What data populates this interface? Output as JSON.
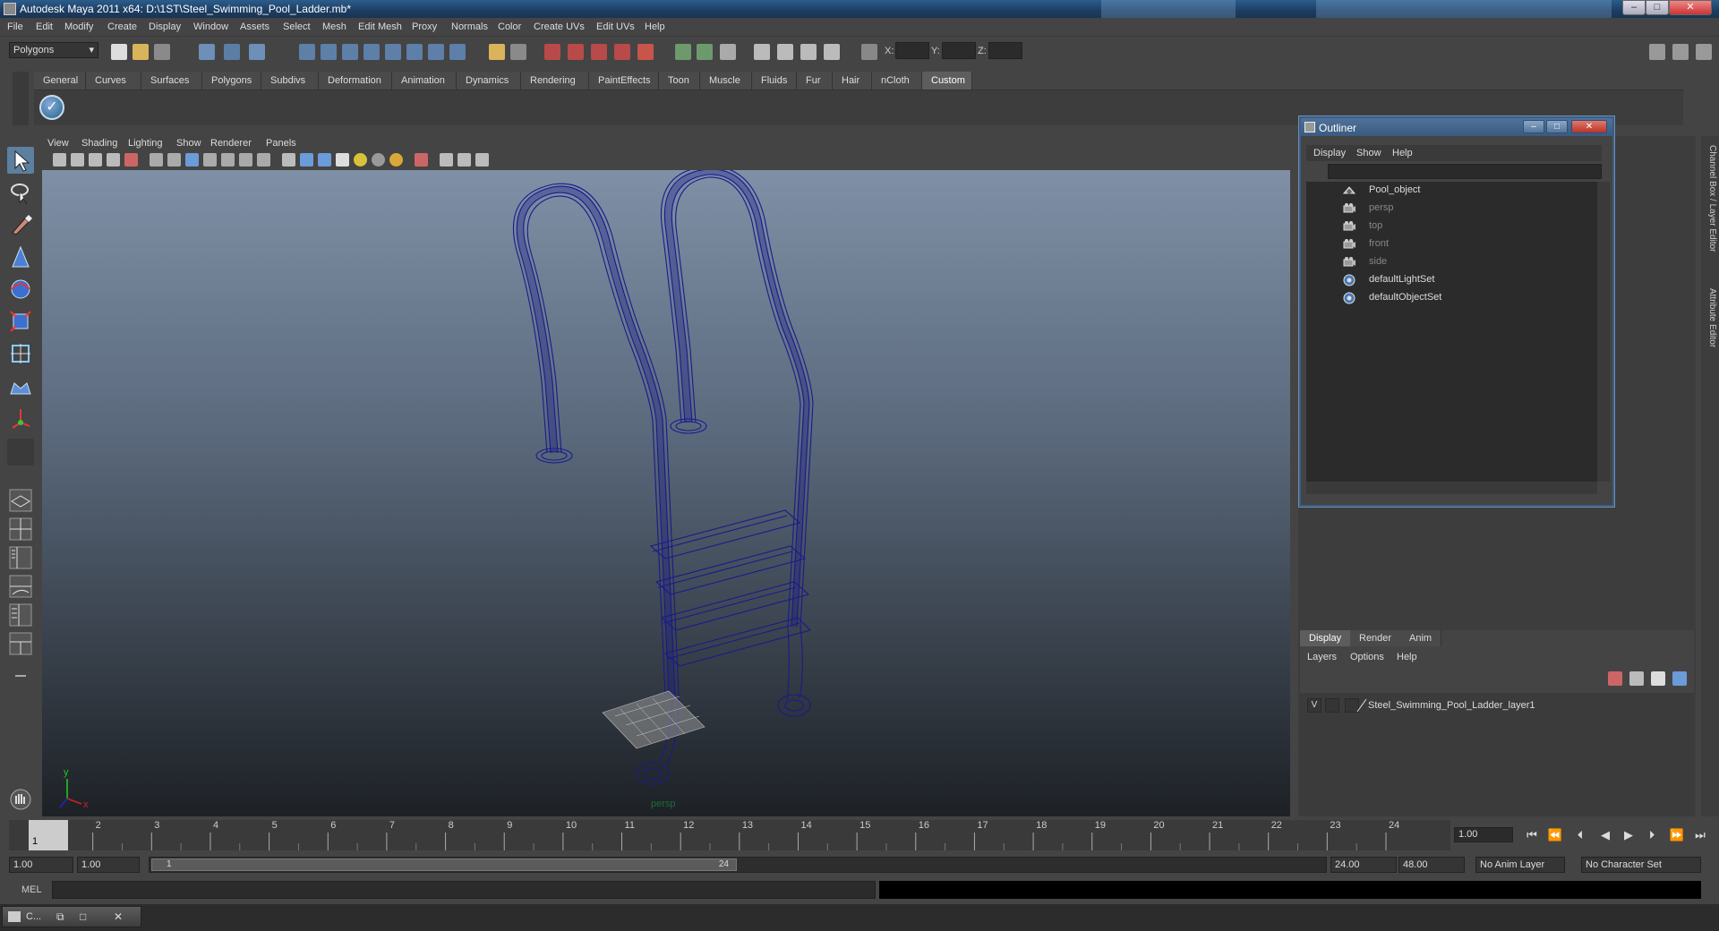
{
  "window": {
    "title": "Autodesk Maya 2011 x64: D:\\1ST\\Steel_Swimming_Pool_Ladder.mb*",
    "minimize": "–",
    "maximize": "□",
    "close": "✕"
  },
  "menubar": [
    "File",
    "Edit",
    "Modify",
    "Create",
    "Display",
    "Window",
    "Assets",
    "Select",
    "Mesh",
    "Edit Mesh",
    "Proxy",
    "Normals",
    "Color",
    "Create UVs",
    "Edit UVs",
    "Help"
  ],
  "statusline": {
    "mode": "Polygons",
    "x_label": "X:",
    "y_label": "Y:",
    "z_label": "Z:"
  },
  "shelf": {
    "tabs": [
      "General",
      "Curves",
      "Surfaces",
      "Polygons",
      "Subdivs",
      "Deformation",
      "Animation",
      "Dynamics",
      "Rendering",
      "PaintEffects",
      "Toon",
      "Muscle",
      "Fluids",
      "Fur",
      "Hair",
      "nCloth",
      "Custom"
    ],
    "active_tab": "Custom",
    "check_icon": "✓"
  },
  "panel_menu": [
    "View",
    "Shading",
    "Lighting",
    "Show",
    "Renderer",
    "Panels"
  ],
  "viewport": {
    "camera": "persp",
    "axis_y": "y",
    "axis_x": "x",
    "wire_color": "#1a1a8c"
  },
  "outliner": {
    "title": "Outliner",
    "menu": [
      "Display",
      "Show",
      "Help"
    ],
    "items": [
      {
        "label": "Pool_object",
        "icon": "transform-icon",
        "dim": false
      },
      {
        "label": "persp",
        "icon": "camera-icon",
        "dim": true
      },
      {
        "label": "top",
        "icon": "camera-icon",
        "dim": true
      },
      {
        "label": "front",
        "icon": "camera-icon",
        "dim": true
      },
      {
        "label": "side",
        "icon": "camera-icon",
        "dim": true
      },
      {
        "label": "defaultLightSet",
        "icon": "set-icon",
        "dim": false
      },
      {
        "label": "defaultObjectSet",
        "icon": "set-icon",
        "dim": false
      }
    ]
  },
  "side_tabs": [
    "Channel Box / Layer Editor",
    "Attribute Editor"
  ],
  "layer_editor": {
    "tabs": [
      "Display",
      "Render",
      "Anim"
    ],
    "active_tab": "Display",
    "menu": [
      "Layers",
      "Options",
      "Help"
    ],
    "layers": [
      {
        "visible": "V",
        "name": "Steel_Swimming_Pool_Ladder_layer1"
      }
    ]
  },
  "timeline": {
    "ticks": [
      "1",
      "2",
      "3",
      "4",
      "5",
      "6",
      "7",
      "8",
      "9",
      "10",
      "11",
      "12",
      "13",
      "14",
      "15",
      "16",
      "17",
      "18",
      "19",
      "20",
      "21",
      "22",
      "23",
      "24"
    ],
    "current_frame": "1",
    "current_time": "1.00"
  },
  "range": {
    "start": "1.00",
    "playback_start": "1.00",
    "handle_start": "1",
    "handle_end": "24",
    "playback_end": "24.00",
    "end": "48.00",
    "anim_layer": "No Anim Layer",
    "character_set": "No Character Set"
  },
  "commandline": {
    "label": "MEL"
  },
  "taskbar": {
    "item_label": "C..."
  }
}
